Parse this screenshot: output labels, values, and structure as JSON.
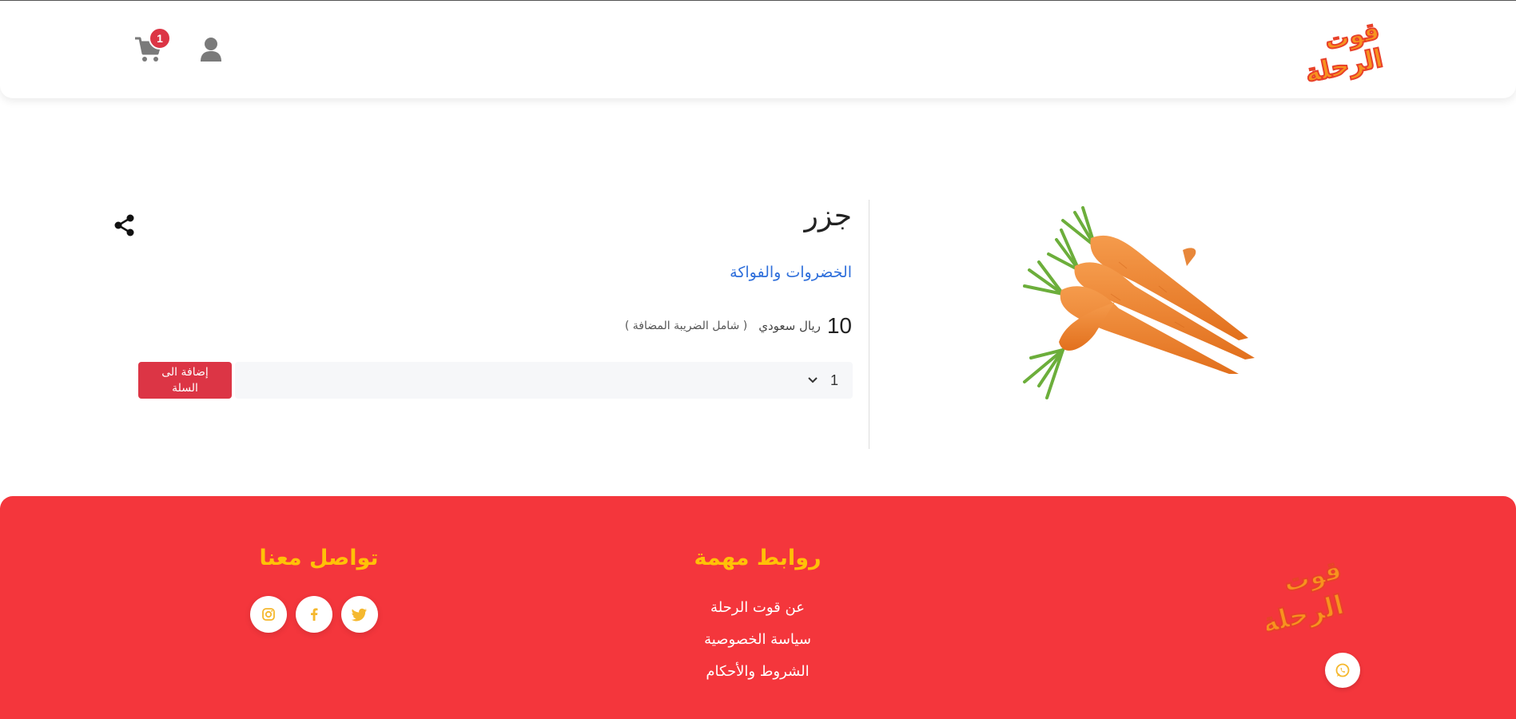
{
  "header": {
    "logo_text": "قوت الرحلة",
    "cart_count": "1",
    "cart_icon": "cart-icon",
    "user_icon": "user-icon"
  },
  "product": {
    "name": "جزر",
    "category": "الخضروات والفواكة",
    "price": "10",
    "currency": "ريال سعودي",
    "tax_note": "( شامل الضريبة المضافة )",
    "image_icon": "carrot-image",
    "share_icon": "share-icon",
    "quantity": "1",
    "add_to_cart_label": "إضافة الى السلة"
  },
  "footer": {
    "logo_text": "قوت الرحلة",
    "links_heading": "روابط مهمة",
    "links": [
      {
        "label": "عن قوت الرحلة"
      },
      {
        "label": "سياسة الخصوصية"
      },
      {
        "label": "الشروط والأحكام"
      }
    ],
    "contact_heading": "تواصل معنا",
    "social": [
      "twitter-icon",
      "facebook-icon",
      "instagram-icon"
    ],
    "whatsapp_icon": "whatsapp-icon"
  },
  "colors": {
    "brand_red": "#f4363c",
    "button_red": "#dc3545",
    "heading_yellow": "#ffc107",
    "link_blue": "#2f6fdb",
    "logo_orange": "#f7931e"
  }
}
